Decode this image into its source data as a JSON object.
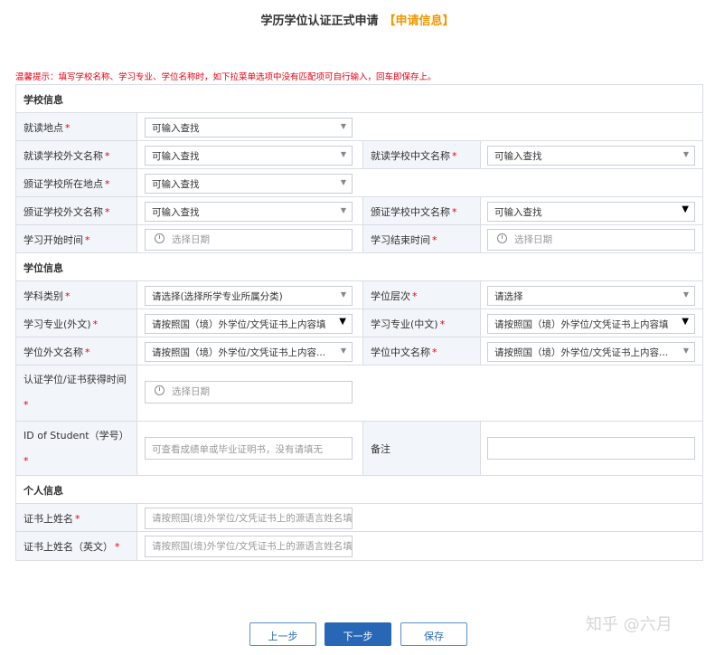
{
  "header": {
    "title": "学历学位认证正式申请",
    "highlight": "【申请信息】"
  },
  "tip": "温馨提示：填写学校名称、学习专业、学位名称时，如下拉菜单选项中没有匹配项可自行输入，回车即保存上。",
  "sections": {
    "school": "学校信息",
    "degree": "学位信息",
    "personal": "个人信息"
  },
  "fields": {
    "study_location": {
      "label": "就读地点",
      "req": "*",
      "value": "可输入查找"
    },
    "school_foreign": {
      "label": "就读学校外文名称",
      "req": "*",
      "value": "可输入查找"
    },
    "school_chinese": {
      "label": "就读学校中文名称",
      "req": "*",
      "value": "可输入查找"
    },
    "issuer_location": {
      "label": "颁证学校所在地点",
      "req": "*",
      "value": "可输入查找"
    },
    "issuer_foreign": {
      "label": "颁证学校外文名称",
      "req": "*",
      "value": "可输入查找"
    },
    "issuer_chinese": {
      "label": "颁证学校中文名称",
      "req": "*",
      "value": "可输入查找"
    },
    "start_time": {
      "label": "学习开始时间",
      "req": "*",
      "placeholder": "选择日期"
    },
    "end_time": {
      "label": "学习结束时间",
      "req": "*",
      "placeholder": "选择日期"
    },
    "subject_category": {
      "label": "学科类别",
      "req": "*",
      "value": "请选择(选择所学专业所属分类)"
    },
    "degree_level": {
      "label": "学位层次",
      "req": "*",
      "value": "请选择"
    },
    "major_foreign": {
      "label": "学习专业(外文)",
      "req": "*",
      "value": "请按照国（境）外学位/文凭证书上内容填"
    },
    "major_chinese": {
      "label": "学习专业(中文)",
      "req": "*",
      "value": "请按照国（境）外学位/文凭证书上内容填"
    },
    "degree_foreign": {
      "label": "学位外文名称",
      "req": "*",
      "value": "请按照国（境）外学位/文凭证书上内容..."
    },
    "degree_chinese": {
      "label": "学位中文名称",
      "req": "*",
      "value": "请按照国（境）外学位/文凭证书上内容..."
    },
    "degree_obtained_time": {
      "label": "认证学位/证书获得时间",
      "req": "*",
      "placeholder": "选择日期"
    },
    "student_id": {
      "label": "ID of Student（学号）",
      "req": "*",
      "placeholder": "可查看成绩单或毕业证明书，没有请填无"
    },
    "remarks": {
      "label": "备注",
      "value": ""
    },
    "cert_name": {
      "label": "证书上姓名",
      "req": "*",
      "placeholder": "请按照国(境)外学位/文凭证书上的源语言姓名填"
    },
    "cert_name_en": {
      "label": "证书上姓名（英文）",
      "req": "*",
      "placeholder": "请按照国(境)外学位/文凭证书上的源语言姓名填"
    }
  },
  "buttons": {
    "prev": "上一步",
    "next": "下一步",
    "save": "保存"
  },
  "watermark": "知乎 @六月",
  "colors": {
    "accent": "#2767b5",
    "highlight": "#f39800",
    "required": "#e60012",
    "label_bg": "#f2f5fa"
  }
}
